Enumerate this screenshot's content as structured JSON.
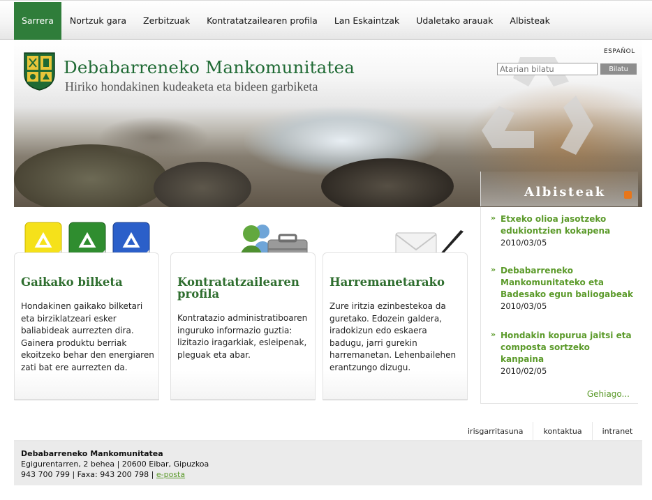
{
  "nav": {
    "items": [
      "Sarrera",
      "Nortzuk gara",
      "Zerbitzuak",
      "Kontratatzailearen profila",
      "Lan Eskaintzak",
      "Udaletako arauak",
      "Albisteak"
    ],
    "active_index": 0
  },
  "header": {
    "title": "Debabarreneko Mankomunitatea",
    "subtitle": "Hiriko hondakinen kudeaketa eta bideen garbiketa",
    "language_link": "ESPAÑOL",
    "search": {
      "placeholder": "Atarian bilatu",
      "button": "Bilatu"
    }
  },
  "news": {
    "heading": "Albisteak",
    "items": [
      {
        "title": "Etxeko olioa jasotzeko edukiontzien kokapena",
        "date": "2010/03/05"
      },
      {
        "title": "Debabarreneko Mankomunitateko eta Badesako egun baliogabeak",
        "date": "2010/03/05"
      },
      {
        "title": "Hondakin kopurua jaitsi eta composta sortzeko kanpaina",
        "date": "2010/02/05"
      }
    ],
    "more": "Gehiago..."
  },
  "boxes": [
    {
      "title": "Gaikako bilketa",
      "text": "Hondakinen gaikako bilketari eta birziklatzeari esker baliabideak aurrezten dira. Gainera produktu berriak ekoitzeko behar den energiaren zati bat ere aurrezten da."
    },
    {
      "title": "Kontratatzailearen profila",
      "text": "Kontratazio administratiboaren inguruko informazio guztia: lizitazio iragarkiak, esleipenak, pleguak eta abar."
    },
    {
      "title": "Harremanetarako",
      "text": "Zure iritzia ezinbestekoa da guretako. Edozein galdera, iradokizun edo eskaera badugu, jarri gurekin harremanetan. Lehenbailehen erantzungo dizugu."
    }
  ],
  "footer": {
    "links": [
      "irisgarritasuna",
      "kontaktua",
      "intranet"
    ],
    "org": "Debabarreneko Mankomunitatea",
    "address": "Egigurentarren, 2 behea | 20600 Eibar, Gipuzkoa",
    "phones": "943 700 799 | Faxa: 943 200 798 | ",
    "email_label": "e-posta"
  },
  "colors": {
    "accent": "#2f7d3a",
    "link_green": "#5b9a2a"
  }
}
